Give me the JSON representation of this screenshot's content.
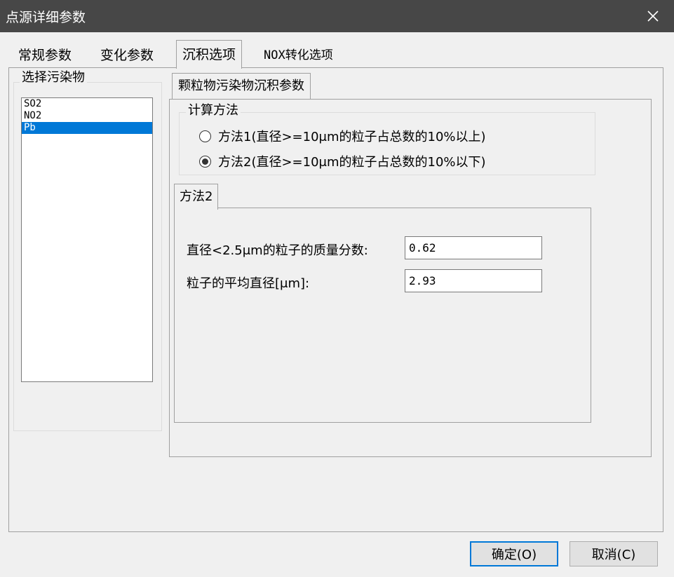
{
  "window": {
    "title": "点源详细参数",
    "close_icon": "close-icon"
  },
  "tabs": [
    {
      "label": "常规参数"
    },
    {
      "label": "变化参数"
    },
    {
      "label": "沉积选项",
      "active": true
    },
    {
      "label": "NOX转化选项"
    }
  ],
  "pollutant_group": {
    "label": "选择污染物",
    "items": [
      {
        "label": "SO2"
      },
      {
        "label": "NO2"
      },
      {
        "label": "Pb",
        "selected": true
      }
    ]
  },
  "deposition": {
    "tab_label": "颗粒物污染物沉积参数",
    "method_group": {
      "label": "计算方法",
      "options": [
        {
          "label": "方法1(直径>=10μm的粒子占总数的10%以上)",
          "checked": false
        },
        {
          "label": "方法2(直径>=10μm的粒子占总数的10%以下)",
          "checked": true
        }
      ]
    },
    "method_tab_label": "方法2",
    "fields": [
      {
        "label": "直径<2.5μm的粒子的质量分数:",
        "value": "0.62"
      },
      {
        "label": "粒子的平均直径[μm]:",
        "value": "2.93"
      }
    ]
  },
  "buttons": {
    "ok": "确定(O)",
    "cancel": "取消(C)"
  },
  "colors": {
    "titlebar": "#474747",
    "selection": "#0078d7",
    "background": "#f0f0f0"
  }
}
